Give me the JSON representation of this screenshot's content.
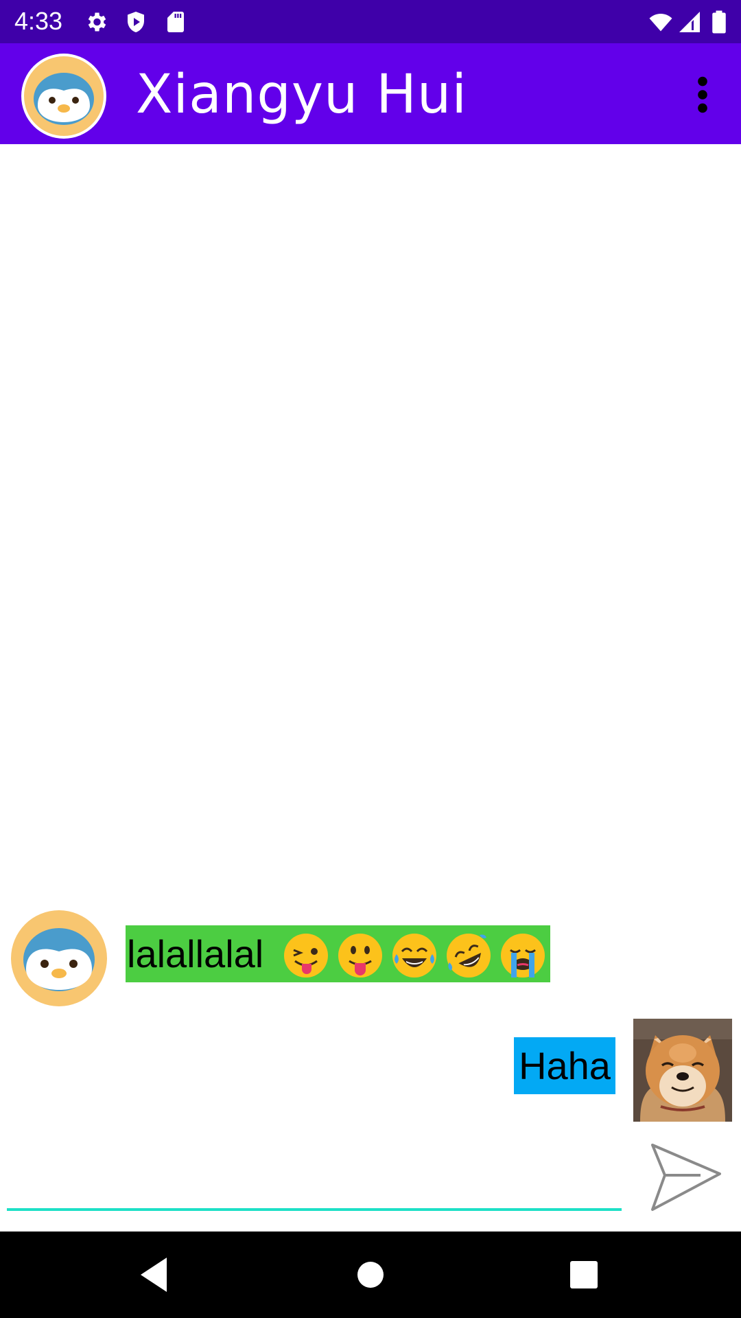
{
  "status_bar": {
    "time": "4:33",
    "left_icons": [
      "settings-icon",
      "shield-play-icon",
      "sd-card-icon"
    ],
    "right_icons": [
      "wifi-icon",
      "signal-icon",
      "battery-icon"
    ]
  },
  "app_bar": {
    "title": "Xiangyu Hui",
    "avatar": "penguin-avatar",
    "menu_icon": "more-vert-icon",
    "background": "#6200ea"
  },
  "messages": [
    {
      "direction": "incoming",
      "avatar": "penguin-avatar",
      "text": "lalallalal",
      "emojis": [
        "😜",
        "😛",
        "😂",
        "🤣",
        "😭"
      ],
      "bubble_color": "#4ccd42"
    },
    {
      "direction": "outgoing",
      "avatar": "shiba-dog-photo",
      "text": "Haha",
      "bubble_color": "#03a9f4"
    }
  ],
  "composer": {
    "value": "",
    "placeholder": "",
    "send_icon": "send-icon",
    "underline_color": "#1de0c6"
  },
  "nav_bar": {
    "buttons": [
      "back-icon",
      "home-icon",
      "recents-icon"
    ]
  }
}
